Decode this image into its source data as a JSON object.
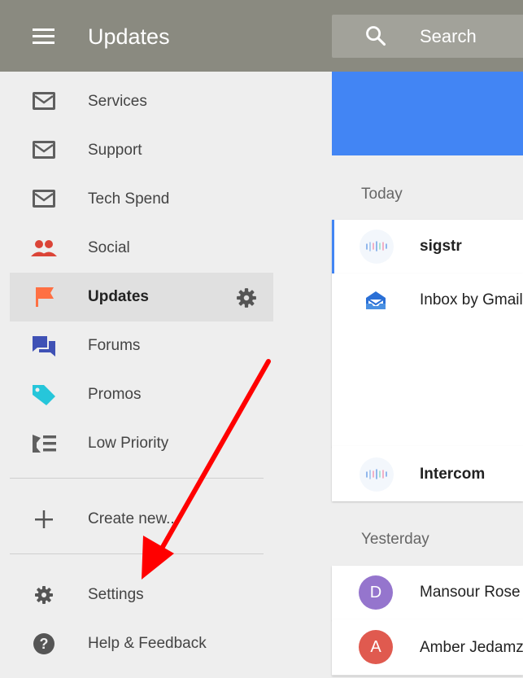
{
  "header": {
    "title": "Updates",
    "search_label": "Search"
  },
  "sidebar": {
    "items": [
      {
        "label": "Services",
        "icon": "mail-icon"
      },
      {
        "label": "Support",
        "icon": "mail-icon"
      },
      {
        "label": "Tech Spend",
        "icon": "mail-icon"
      },
      {
        "label": "Social",
        "icon": "people-icon"
      },
      {
        "label": "Updates",
        "icon": "flag-icon",
        "active": true
      },
      {
        "label": "Forums",
        "icon": "forum-icon"
      },
      {
        "label": "Promos",
        "icon": "tag-icon"
      },
      {
        "label": "Low Priority",
        "icon": "low-priority-icon"
      }
    ],
    "create_new": "Create new...",
    "settings": "Settings",
    "help": "Help & Feedback"
  },
  "main": {
    "sections": [
      {
        "header": "Today",
        "items": [
          {
            "sender": "sigstr",
            "bold": true,
            "unread": true
          },
          {
            "sender": "Inbox by Gmail",
            "bold": false
          },
          {
            "sender": "Intercom",
            "bold": true
          }
        ]
      },
      {
        "header": "Yesterday",
        "items": [
          {
            "sender": "Mansour Rose",
            "avatar_letter": "D"
          },
          {
            "sender": "Amber Jedamz",
            "avatar_letter": "A"
          }
        ]
      }
    ]
  },
  "colors": {
    "topbar": "#8a8a80",
    "accent": "#4285f4",
    "social": "#db4437",
    "updates": "#ff7043",
    "forums": "#3f51b5",
    "promos": "#26c6da",
    "avatar_d": "#9575cd",
    "avatar_a": "#e05a4f",
    "arrow": "#ff0000"
  }
}
